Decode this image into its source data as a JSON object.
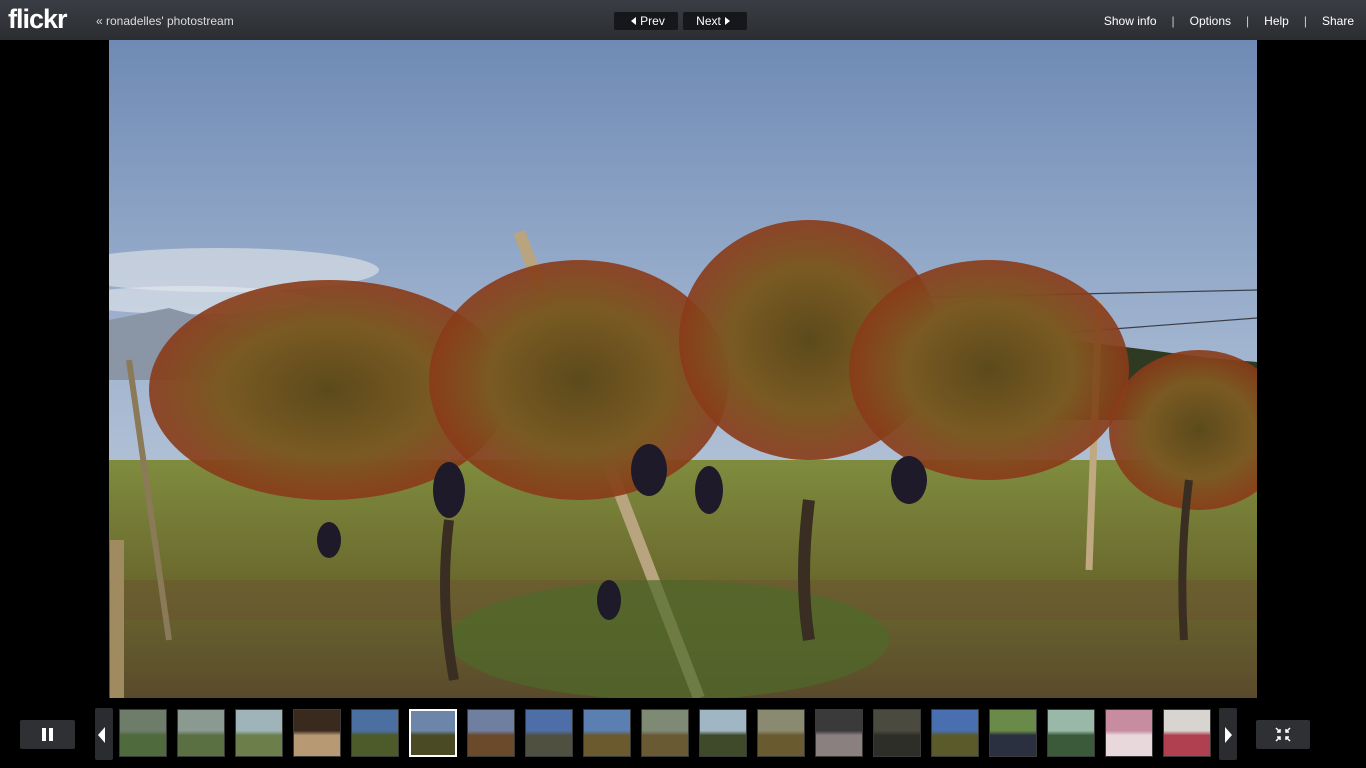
{
  "app": {
    "logo": "flickr",
    "back_link": "« ronadelles' photostream"
  },
  "nav": {
    "prev_label": "Prev",
    "next_label": "Next"
  },
  "top_menu": {
    "show_info": "Show info",
    "options": "Options",
    "help": "Help",
    "share": "Share",
    "separator": "|"
  },
  "slideshow": {
    "state": "playing",
    "selected_index": 5,
    "thumbnails": [
      {
        "id": "t1",
        "colors": [
          "#6d7d6a",
          "#4f6a3d"
        ]
      },
      {
        "id": "t2",
        "colors": [
          "#8a9a90",
          "#5a6f42"
        ]
      },
      {
        "id": "t3",
        "colors": [
          "#9fb4b8",
          "#6c7e4a"
        ]
      },
      {
        "id": "t4",
        "colors": [
          "#3a2a1e",
          "#b79a74"
        ]
      },
      {
        "id": "t5",
        "colors": [
          "#4a6fa0",
          "#4d5a2a"
        ]
      },
      {
        "id": "t6",
        "colors": [
          "#6b86a8",
          "#4a4a24"
        ]
      },
      {
        "id": "t7",
        "colors": [
          "#6f7fa0",
          "#6a4a2a"
        ]
      },
      {
        "id": "t8",
        "colors": [
          "#4e6ea8",
          "#505040"
        ]
      },
      {
        "id": "t9",
        "colors": [
          "#5a7fb0",
          "#6a5a2e"
        ]
      },
      {
        "id": "t10",
        "colors": [
          "#7e8a74",
          "#6a5a34"
        ]
      },
      {
        "id": "t11",
        "colors": [
          "#a0b6c4",
          "#3e4a2a"
        ]
      },
      {
        "id": "t12",
        "colors": [
          "#8a8a70",
          "#6a5a30"
        ]
      },
      {
        "id": "t13",
        "colors": [
          "#3a3a3a",
          "#8a8080"
        ]
      },
      {
        "id": "t14",
        "colors": [
          "#4a4a3e",
          "#2e2e28"
        ]
      },
      {
        "id": "t15",
        "colors": [
          "#4a6fb0",
          "#5a5a2a"
        ]
      },
      {
        "id": "t16",
        "colors": [
          "#6a8a4a",
          "#2a3040"
        ]
      },
      {
        "id": "t17",
        "colors": [
          "#9ab8a8",
          "#3a5a3a"
        ]
      },
      {
        "id": "t18",
        "colors": [
          "#c88ca0",
          "#e8d8dc"
        ]
      },
      {
        "id": "t19",
        "colors": [
          "#d8d4d0",
          "#b04050"
        ]
      }
    ]
  },
  "colors": {
    "topbar": "#32353b",
    "background": "#000000"
  }
}
